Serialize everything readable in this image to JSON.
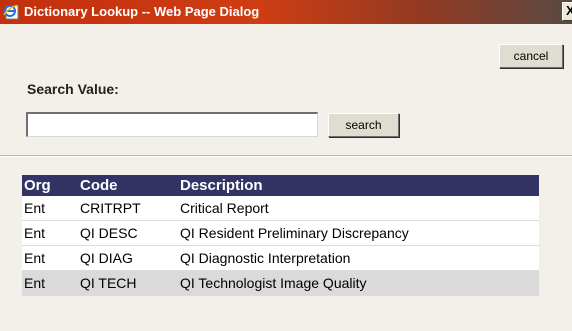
{
  "window": {
    "title": "Dictionary Lookup -- Web Page Dialog",
    "close_glyph": "X"
  },
  "toolbar": {
    "cancel_label": "cancel"
  },
  "search": {
    "label": "Search Value:",
    "value": "",
    "placeholder": "",
    "button_label": "search"
  },
  "table": {
    "headers": [
      "Org",
      "Code",
      "Description"
    ],
    "rows": [
      {
        "org": "Ent",
        "code": "CRITRPT",
        "description": "Critical Report"
      },
      {
        "org": "Ent",
        "code": "QI DESC",
        "description": "QI Resident Preliminary Discrepancy"
      },
      {
        "org": "Ent",
        "code": "QI DIAG",
        "description": "QI Diagnostic Interpretation"
      },
      {
        "org": "Ent",
        "code": "QI TECH",
        "description": "QI Technologist Image Quality"
      }
    ]
  },
  "colors": {
    "titlebar": "#c2300e",
    "table_header": "#333366",
    "background": "#f2f0e8"
  },
  "icons": {
    "title_icon": "ie-page-icon"
  }
}
